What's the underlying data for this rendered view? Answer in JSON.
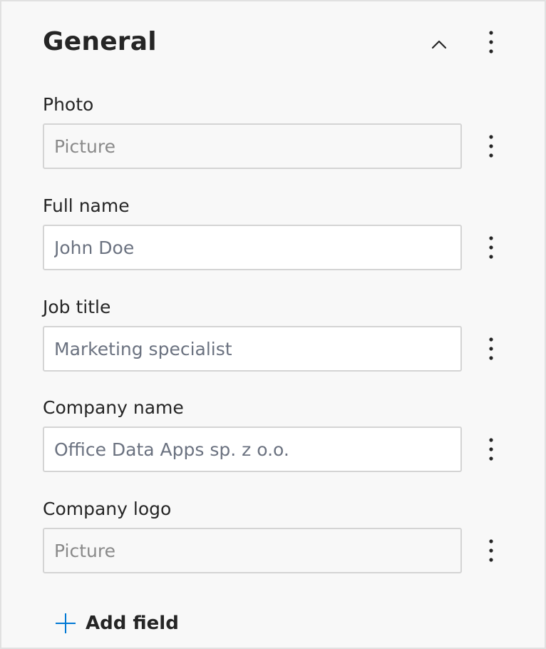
{
  "section": {
    "title": "General",
    "collapse_icon": "chevron-up-icon",
    "menu_icon": "more-vertical-icon"
  },
  "fields": [
    {
      "label": "Photo",
      "placeholder": "Picture",
      "type": "picture"
    },
    {
      "label": "Full name",
      "placeholder": "John Doe",
      "type": "text"
    },
    {
      "label": "Job title",
      "placeholder": "Marketing specialist",
      "type": "text"
    },
    {
      "label": "Company name",
      "placeholder": "Office Data Apps sp. z o.o.",
      "type": "text"
    },
    {
      "label": "Company logo",
      "placeholder": "Picture",
      "type": "picture"
    }
  ],
  "add_field": {
    "label": "Add field",
    "icon": "plus-icon",
    "icon_color": "#0078d4"
  }
}
